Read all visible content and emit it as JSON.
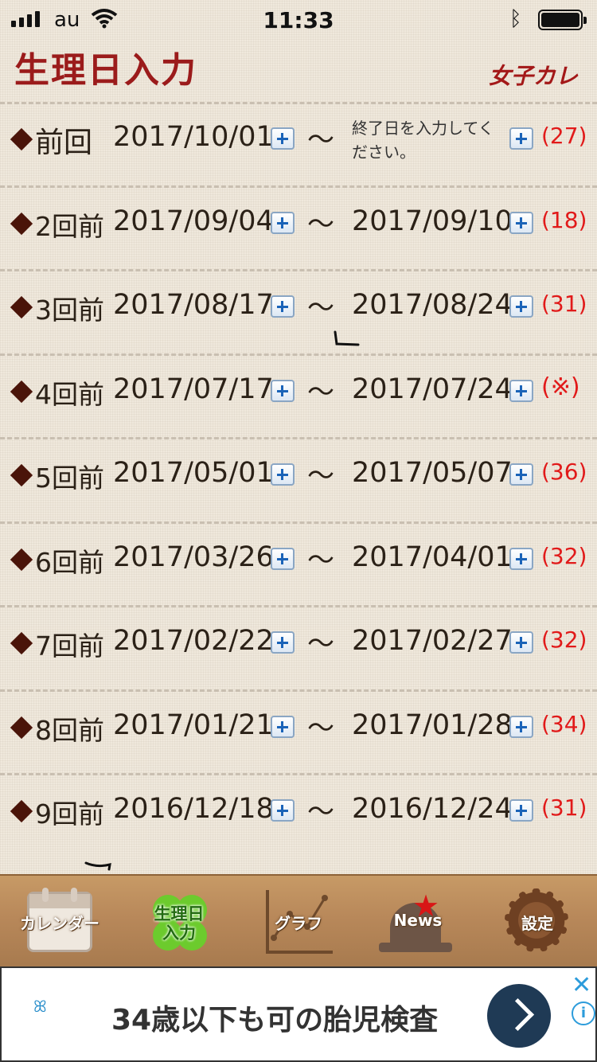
{
  "status_bar": {
    "carrier": "au",
    "time": "11:33"
  },
  "header": {
    "title": "生理日入力",
    "brand": "女子カレ"
  },
  "periods": [
    {
      "label": "前回",
      "start": "2017/10/01",
      "end": "",
      "end_placeholder": "終了日を入力してください。",
      "days": "(27)"
    },
    {
      "label": "2回前",
      "start": "2017/09/04",
      "end": "2017/09/10",
      "days": "(18)"
    },
    {
      "label": "3回前",
      "start": "2017/08/17",
      "end": "2017/08/24",
      "days": "(31)"
    },
    {
      "label": "4回前",
      "start": "2017/07/17",
      "end": "2017/07/24",
      "days": "(※)"
    },
    {
      "label": "5回前",
      "start": "2017/05/01",
      "end": "2017/05/07",
      "days": "(36)"
    },
    {
      "label": "6回前",
      "start": "2017/03/26",
      "end": "2017/04/01",
      "days": "(32)"
    },
    {
      "label": "7回前",
      "start": "2017/02/22",
      "end": "2017/02/27",
      "days": "(32)"
    },
    {
      "label": "8回前",
      "start": "2017/01/21",
      "end": "2017/01/28",
      "days": "(34)"
    },
    {
      "label": "9回前",
      "start": "2016/12/18",
      "end": "2016/12/24",
      "days": "(31)"
    }
  ],
  "separator": "〜",
  "tabs": [
    {
      "label": "カレンダー",
      "icon": "calendar-icon"
    },
    {
      "label_line1": "生理日",
      "label_line2": "入力",
      "icon": "clover-icon",
      "active": true
    },
    {
      "label": "グラフ",
      "icon": "graph-icon"
    },
    {
      "label": "News",
      "icon": "bell-star-icon"
    },
    {
      "label": "設定",
      "icon": "gear-icon"
    }
  ],
  "ad": {
    "headline": "34歳以下も可の胎児検査",
    "close": "✕",
    "info": "i"
  },
  "colors": {
    "title": "#9b1b1b",
    "days": "#e11a1a",
    "plus": "#1a63b8",
    "tabbar": "#b8885a"
  }
}
